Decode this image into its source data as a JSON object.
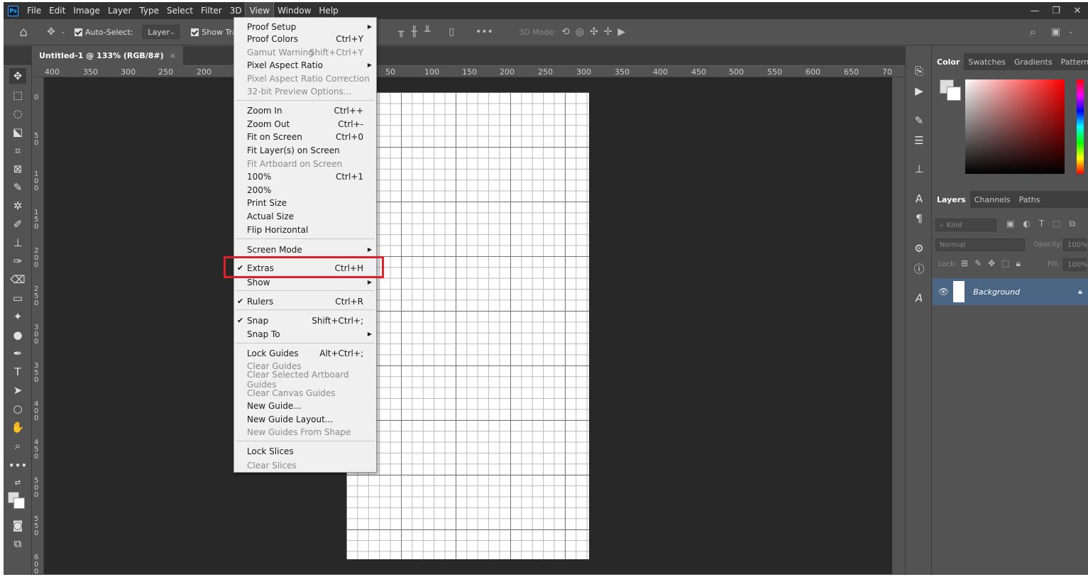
{
  "menubar": {
    "items": [
      "File",
      "Edit",
      "Image",
      "Layer",
      "Type",
      "Select",
      "Filter",
      "3D",
      "View",
      "Window",
      "Help"
    ],
    "active": "View",
    "logo": "Ps"
  },
  "options": {
    "auto_select_label": "Auto-Select:",
    "layer_dropdown": "Layer",
    "show_transform": "Show Tra",
    "mode_3d": "3D Mode:"
  },
  "document": {
    "tab_title": "Untitled-1 @ 133% (RGB/8#)",
    "close": "×"
  },
  "ruler": {
    "h_labels": [
      "400",
      "350",
      "300",
      "250",
      "200",
      "50",
      "100",
      "150",
      "200",
      "250",
      "300",
      "350",
      "400",
      "450",
      "500",
      "550",
      "600",
      "650",
      "70"
    ],
    "v_labels": [
      "0",
      "50",
      "100",
      "150",
      "200",
      "250",
      "300",
      "350",
      "400",
      "450",
      "500",
      "550",
      "600"
    ]
  },
  "view_menu": {
    "proof_setup": "Proof Setup",
    "proof_colors": "Proof Colors",
    "proof_colors_sc": "Ctrl+Y",
    "gamut_warning": "Gamut Warning",
    "gamut_warning_sc": "Shift+Ctrl+Y",
    "pixel_aspect_ratio": "Pixel Aspect Ratio",
    "pixel_aspect_ratio_correction": "Pixel Aspect Ratio Correction",
    "preview_32bit": "32-bit Preview Options...",
    "zoom_in": "Zoom In",
    "zoom_in_sc": "Ctrl++",
    "zoom_out": "Zoom Out",
    "zoom_out_sc": "Ctrl+-",
    "fit_on_screen": "Fit on Screen",
    "fit_on_screen_sc": "Ctrl+0",
    "fit_layers": "Fit Layer(s) on Screen",
    "fit_artboard": "Fit Artboard on Screen",
    "p100": "100%",
    "p100_sc": "Ctrl+1",
    "p200": "200%",
    "print_size": "Print Size",
    "actual_size": "Actual Size",
    "flip_horizontal": "Flip Horizontal",
    "screen_mode": "Screen Mode",
    "extras": "Extras",
    "extras_sc": "Ctrl+H",
    "show": "Show",
    "rulers": "Rulers",
    "rulers_sc": "Ctrl+R",
    "snap": "Snap",
    "snap_sc": "Shift+Ctrl+;",
    "snap_to": "Snap To",
    "lock_guides": "Lock Guides",
    "lock_guides_sc": "Alt+Ctrl+;",
    "clear_guides": "Clear Guides",
    "clear_selected_artboard_guides": "Clear Selected Artboard Guides",
    "clear_canvas_guides": "Clear Canvas Guides",
    "new_guide": "New Guide...",
    "new_guide_layout": "New Guide Layout...",
    "new_guides_from_shape": "New Guides From Shape",
    "lock_slices": "Lock Slices",
    "clear_slices": "Clear Slices",
    "check": "✔"
  },
  "panels": {
    "color_tabs": [
      "Color",
      "Swatches",
      "Gradients",
      "Patterns"
    ],
    "layer_tabs": [
      "Layers",
      "Channels",
      "Paths"
    ],
    "kind": "Kind",
    "blend": "Normal",
    "opacity_label": "Opacity:",
    "opacity": "100%",
    "lock_label": "Lock:",
    "fill_label": "Fill:",
    "fill": "100%",
    "layer_name": "Background"
  }
}
